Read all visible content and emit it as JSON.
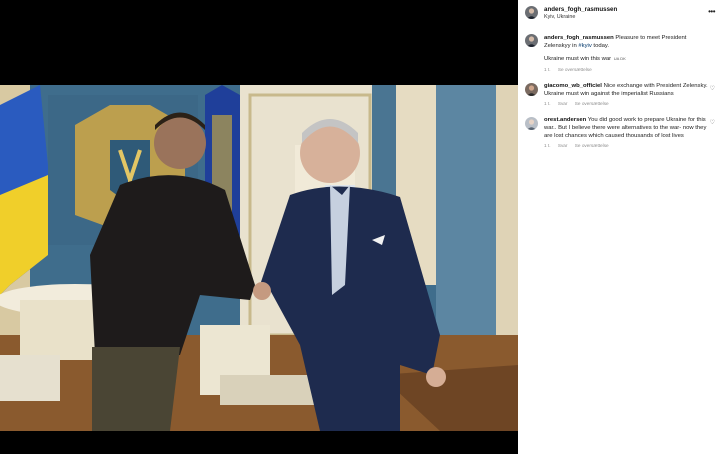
{
  "post": {
    "username": "anders_fogh_rasmussen",
    "location": "Kyiv, Ukraine"
  },
  "caption": {
    "username": "anders_fogh_rasmussen",
    "text_before": " Pleasure to meet President Zelenskyy in ",
    "hashtag": "#kyiv",
    "text_after": " today.",
    "line2": "Ukraine must win this war",
    "flag": "UA DK",
    "age": "1 t.",
    "translate": "Se oversættelse"
  },
  "comments": [
    {
      "username": "giacomo_wb_officiel",
      "text": " Nice exchange with President Zelensky. Ukraine must win against the imperialist Russians",
      "age": "1 t.",
      "reply": "Svar",
      "translate": "Se oversættelse"
    },
    {
      "username": "orest.andersen",
      "text": " You did good work to prepare Ukraine for this war.. But I believe there were alternatives to the war- now they are lost chances which caused thousands of lost lives",
      "age": "1 t.",
      "reply": "Svar",
      "translate": "Se oversættelse"
    }
  ],
  "icons": {
    "more": "more-icon",
    "heart": "heart-icon"
  },
  "colors": {
    "link": "#00376b",
    "meta": "#8e8e8e",
    "backdrop": "#000000"
  }
}
